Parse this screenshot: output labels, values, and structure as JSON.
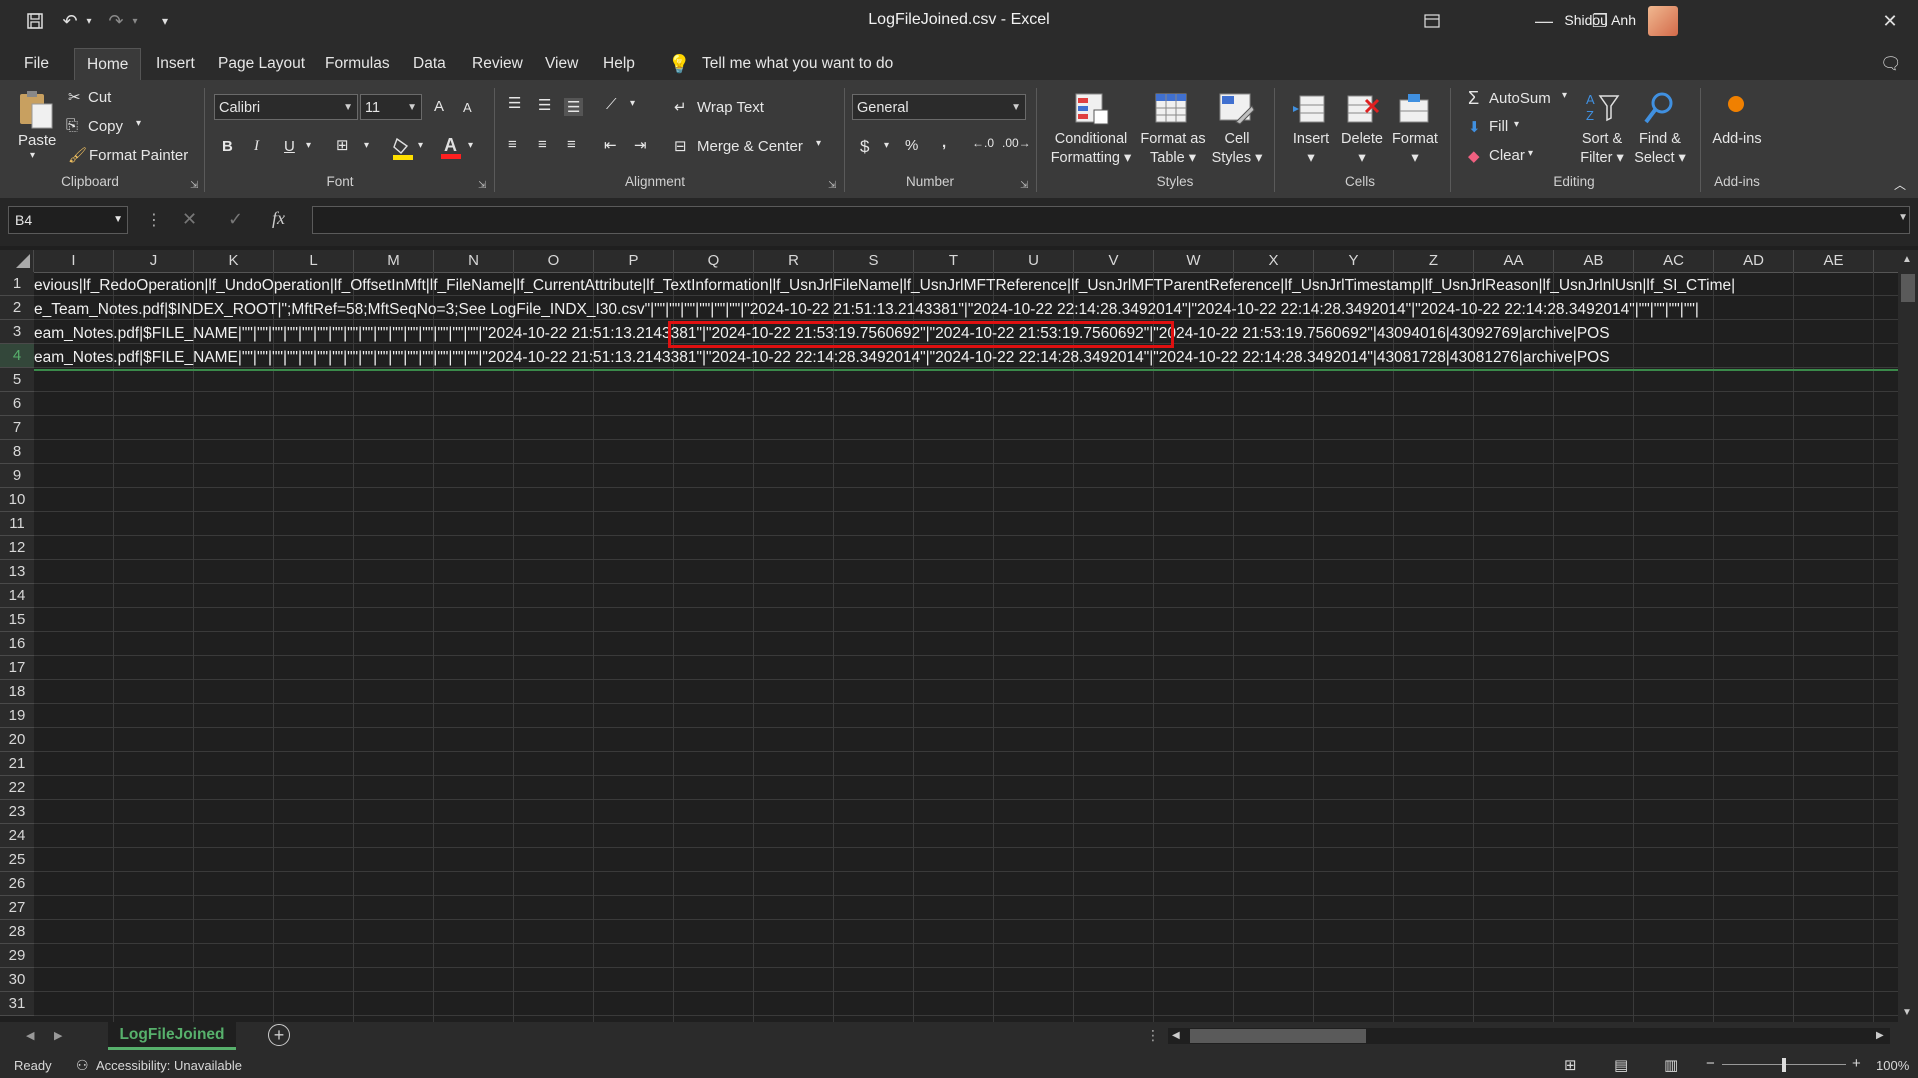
{
  "window": {
    "title": "LogFileJoined.csv  -  Excel",
    "user": "Shidou Anh"
  },
  "menu_tabs": [
    "File",
    "Home",
    "Insert",
    "Page Layout",
    "Formulas",
    "Data",
    "Review",
    "View",
    "Help"
  ],
  "tell_me": "Tell me what you want to do",
  "ribbon": {
    "clipboard": {
      "paste": "Paste",
      "cut": "Cut",
      "copy": "Copy",
      "format_painter": "Format Painter",
      "group": "Clipboard"
    },
    "font": {
      "name": "Calibri",
      "size": "11",
      "group": "Font",
      "bold": "B",
      "italic": "I",
      "underline": "U",
      "grow": "A",
      "shrink": "A"
    },
    "alignment": {
      "wrap": "Wrap Text",
      "merge": "Merge & Center",
      "group": "Alignment"
    },
    "number": {
      "format": "General",
      "currency": "$",
      "percent": "%",
      "comma": ",",
      "group": "Number"
    },
    "styles": {
      "conditional_line1": "Conditional",
      "conditional_line2": "Formatting",
      "format_table_line1": "Format as",
      "format_table_line2": "Table",
      "cell_styles_line1": "Cell",
      "cell_styles_line2": "Styles",
      "group": "Styles"
    },
    "cells": {
      "insert": "Insert",
      "delete": "Delete",
      "format": "Format",
      "group": "Cells"
    },
    "editing": {
      "autosum": "AutoSum",
      "fill": "Fill",
      "clear": "Clear",
      "sort_line1": "Sort &",
      "sort_line2": "Filter",
      "find_line1": "Find &",
      "find_line2": "Select",
      "group": "Editing"
    },
    "addins": {
      "label": "Add-ins",
      "group": "Add-ins"
    }
  },
  "formula_bar": {
    "name_box": "B4",
    "fx": "fx",
    "value": ""
  },
  "columns": [
    "I",
    "J",
    "K",
    "L",
    "M",
    "N",
    "O",
    "P",
    "Q",
    "R",
    "S",
    "T",
    "U",
    "V",
    "W",
    "X",
    "Y",
    "Z",
    "AA",
    "AB",
    "AC",
    "AD",
    "AE"
  ],
  "rows": [
    "1",
    "2",
    "3",
    "4",
    "5",
    "6",
    "7",
    "8",
    "9",
    "10",
    "11",
    "12",
    "13",
    "14",
    "15",
    "16",
    "17",
    "18",
    "19",
    "20",
    "21",
    "22",
    "23",
    "24",
    "25",
    "26",
    "27",
    "28",
    "29",
    "30",
    "31"
  ],
  "cells": {
    "row1": "evious|lf_RedoOperation|lf_UndoOperation|lf_OffsetInMft|lf_FileName|lf_CurrentAttribute|lf_TextInformation|lf_UsnJrlFileName|lf_UsnJrlMFTReference|lf_UsnJrlMFTParentReference|lf_UsnJrlTimestamp|lf_UsnJrlReason|lf_UsnJrlnlUsn|lf_SI_CTime|",
    "row2": "e_Team_Notes.pdf|$INDEX_ROOT|\";MftRef=58;MftSeqNo=3;See LogFile_INDX_I30.csv\"|\"\"|\"\"|\"\"|\"\"|\"\"|\"\"|\"2024-10-22 21:51:13.2143381\"|\"2024-10-22 22:14:28.3492014\"|\"2024-10-22 22:14:28.3492014\"|\"2024-10-22 22:14:28.3492014\"|\"\"|\"\"|\"\"|\"\"|",
    "row3": "eam_Notes.pdf|$FILE_NAME|\"\"|\"\"|\"\"|\"\"|\"\"|\"\"|\"\"|\"\"|\"\"|\"\"|\"\"|\"\"|\"\"|\"\"|\"\"|\"\"|\"2024-10-22 21:51:13.2143381\"|\"2024-10-22 21:53:19.7560692\"|\"2024-10-22 21:53:19.7560692\"|\"2024-10-22 21:53:19.7560692\"|43094016|43092769|archive|POS",
    "row4": "eam_Notes.pdf|$FILE_NAME|\"\"|\"\"|\"\"|\"\"|\"\"|\"\"|\"\"|\"\"|\"\"|\"\"|\"\"|\"\"|\"\"|\"\"|\"\"|\"\"|\"2024-10-22 21:51:13.2143381\"|\"2024-10-22 22:14:28.3492014\"|\"2024-10-22 22:14:28.3492014\"|\"2024-10-22 22:14:28.3492014\"|43081728|43081276|archive|POS"
  },
  "sheet_tab": "LogFileJoined",
  "status": {
    "ready": "Ready",
    "accessibility": "Accessibility: Unavailable",
    "zoom": "100%"
  },
  "colors": {
    "accent_green": "#57b06c",
    "highlight_red": "#e01010",
    "background": "#1f1f1f"
  }
}
